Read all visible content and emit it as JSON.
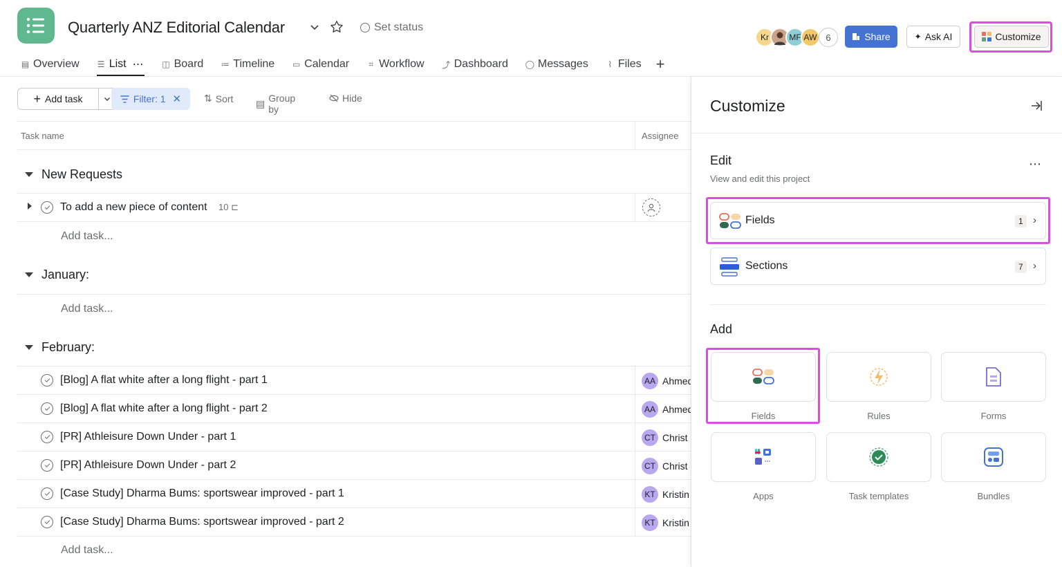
{
  "header": {
    "project_title": "Quarterly ANZ Editorial Calendar",
    "set_status": "Set status",
    "avatars": [
      {
        "initials": "Kr",
        "color": "#f5d78e"
      },
      {
        "initials": "",
        "color": "#c9a48a"
      },
      {
        "initials": "MF",
        "color": "#8fd0d8"
      },
      {
        "initials": "AW",
        "color": "#f3c86b"
      }
    ],
    "member_count": "6",
    "share_label": "Share",
    "askai_label": "Ask AI",
    "customize_label": "Customize"
  },
  "tabs": [
    {
      "label": "Overview",
      "icon": "overview-icon",
      "glyph": "▤"
    },
    {
      "label": "List",
      "icon": "list-icon",
      "glyph": "☰"
    },
    {
      "label": "Board",
      "icon": "board-icon",
      "glyph": "◫"
    },
    {
      "label": "Timeline",
      "icon": "timeline-icon",
      "glyph": "≔"
    },
    {
      "label": "Calendar",
      "icon": "calendar-icon",
      "glyph": "▭"
    },
    {
      "label": "Workflow",
      "icon": "workflow-icon",
      "glyph": "⌗"
    },
    {
      "label": "Dashboard",
      "icon": "dashboard-icon",
      "glyph": "⤴"
    },
    {
      "label": "Messages",
      "icon": "messages-icon",
      "glyph": "◯"
    },
    {
      "label": "Files",
      "icon": "files-icon",
      "glyph": "⌇"
    }
  ],
  "toolbar": {
    "add_task": "Add task",
    "filter": "Filter: 1",
    "sort": "Sort",
    "group_by": "Group by",
    "hide": "Hide"
  },
  "table": {
    "col_task": "Task name",
    "col_assignee": "Assignee",
    "add_task": "Add task...",
    "sections": [
      {
        "name": "New Requests"
      },
      {
        "name": "January:"
      },
      {
        "name": "February:"
      }
    ],
    "new_request_task": {
      "name": "To add a new piece of content",
      "subtasks": "10"
    },
    "february_tasks": [
      {
        "name": "[Blog] A flat white after a long flight - part 1",
        "initials": "AA",
        "assignee": "Ahmed",
        "color": "#b9a7f0"
      },
      {
        "name": "[Blog] A flat white after a long flight - part 2",
        "initials": "AA",
        "assignee": "Ahmed",
        "color": "#b9a7f0"
      },
      {
        "name": "[PR] Athleisure Down Under - part 1",
        "initials": "CT",
        "assignee": "Christ",
        "color": "#b9a7f0"
      },
      {
        "name": "[PR] Athleisure Down Under - part 2",
        "initials": "CT",
        "assignee": "Christ",
        "color": "#b9a7f0"
      },
      {
        "name": "[Case Study] Dharma Bums: sportswear improved - part 1",
        "initials": "KT",
        "assignee": "Kristin",
        "color": "#b9a7f0"
      },
      {
        "name": "[Case Study] Dharma Bums: sportswear improved - part 2",
        "initials": "KT",
        "assignee": "Kristin",
        "color": "#b9a7f0"
      }
    ]
  },
  "panel": {
    "title": "Customize",
    "edit_title": "Edit",
    "edit_subtitle": "View and edit this project",
    "edit_items": [
      {
        "label": "Fields",
        "count": "1"
      },
      {
        "label": "Sections",
        "count": "7"
      }
    ],
    "add_title": "Add",
    "add_tiles": [
      {
        "label": "Fields"
      },
      {
        "label": "Rules"
      },
      {
        "label": "Forms"
      },
      {
        "label": "Apps"
      },
      {
        "label": "Task templates"
      },
      {
        "label": "Bundles"
      }
    ]
  }
}
